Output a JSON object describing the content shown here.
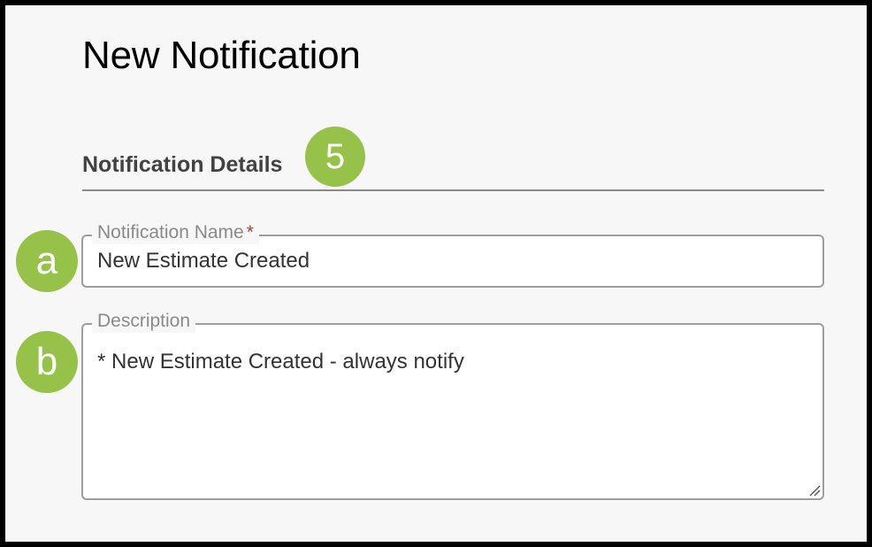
{
  "page": {
    "title": "New Notification"
  },
  "section": {
    "title": "Notification Details",
    "step_badge": "5"
  },
  "fields": {
    "name": {
      "badge": "a",
      "label": "Notification Name",
      "required_mark": "*",
      "value": "New Estimate Created"
    },
    "description": {
      "badge": "b",
      "label": "Description",
      "value": "* New Estimate Created - always notify"
    }
  },
  "colors": {
    "badge": "#97c24a",
    "required": "#c0392b",
    "border": "#9e9e9e",
    "label": "#8a8a8a"
  },
  "icons": {
    "resize": "resize-handle-icon"
  }
}
